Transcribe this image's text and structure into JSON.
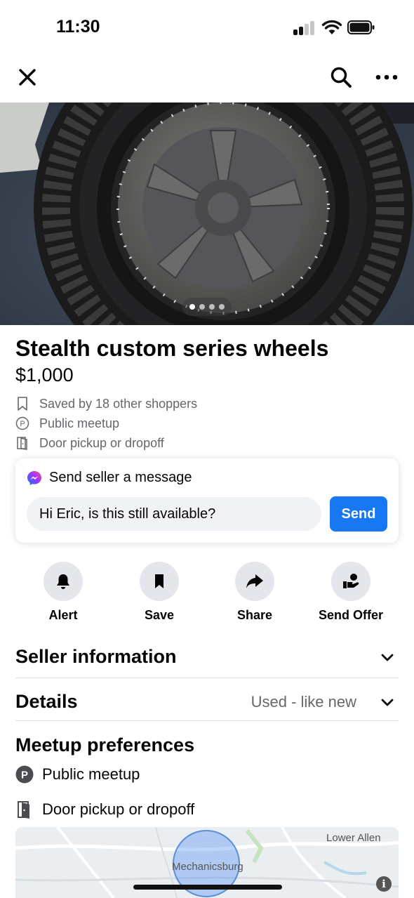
{
  "status_bar": {
    "time": "11:30"
  },
  "nav": {
    "close_icon": "close-icon",
    "search_icon": "search-icon",
    "more_icon": "more-icon"
  },
  "carousel": {
    "total_images": 4,
    "active_index": 0
  },
  "listing": {
    "title": "Stealth custom series wheels",
    "price": "$1,000",
    "saved_text": "Saved by 18 other shoppers",
    "meetup_text": "Public meetup",
    "pickup_text": "Door pickup or dropoff"
  },
  "message": {
    "header": "Send seller a message",
    "input_value": "Hi Eric, is this still available?",
    "send_label": "Send"
  },
  "actions": [
    {
      "label": "Alert",
      "icon": "bell-icon"
    },
    {
      "label": "Save",
      "icon": "bookmark-icon"
    },
    {
      "label": "Share",
      "icon": "share-icon"
    },
    {
      "label": "Send Offer",
      "icon": "offer-icon"
    }
  ],
  "sections": {
    "seller_info": "Seller information",
    "details": "Details",
    "details_value": "Used - like new"
  },
  "meetup": {
    "title": "Meetup preferences",
    "public_meetup": "Public meetup",
    "door_pickup": "Door pickup or dropoff"
  },
  "map": {
    "town_1": "Lower Allen",
    "town_2": "Mechanicsburg",
    "info_glyph": "i"
  },
  "colors": {
    "primary": "#1877f2",
    "secondary_text": "#65676b",
    "button_bg": "#e4e6eb"
  }
}
